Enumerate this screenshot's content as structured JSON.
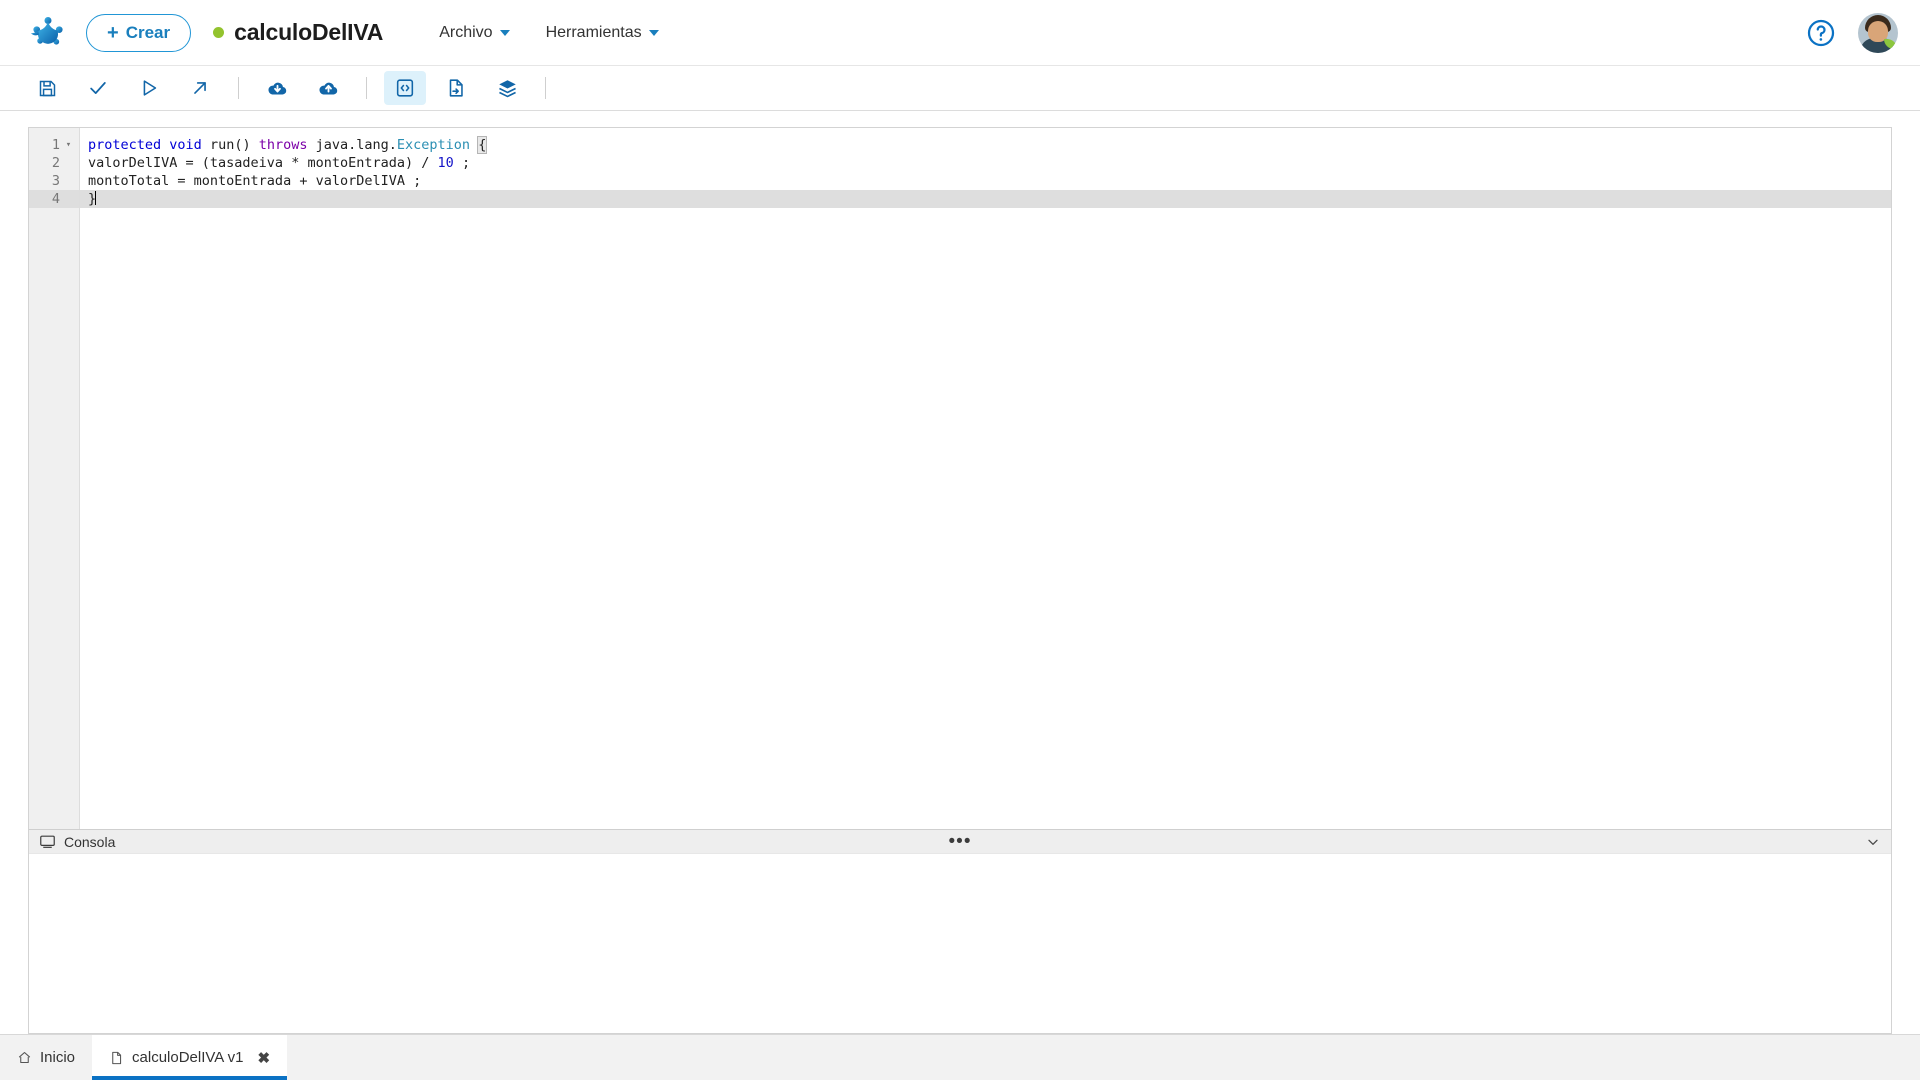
{
  "header": {
    "logo_icon": "mendix-frog-logo",
    "create_button": {
      "label": "Crear",
      "plus": "+"
    },
    "document": {
      "title": "calculoDelIVA",
      "status_dot_color": "#93c32e"
    },
    "menus": [
      {
        "label": "Archivo",
        "name": "menu-archivo"
      },
      {
        "label": "Herramientas",
        "name": "menu-herramientas"
      }
    ],
    "help_icon": "help-circle-icon",
    "avatar": "user-avatar"
  },
  "toolbar": {
    "buttons": [
      {
        "name": "save-button",
        "icon": "save-floppy-icon",
        "title": "Guardar",
        "active": false
      },
      {
        "name": "validate-button",
        "icon": "check-icon",
        "title": "Validar",
        "active": false
      },
      {
        "name": "run-button",
        "icon": "play-icon",
        "title": "Ejecutar",
        "active": false
      },
      {
        "name": "open-external-button",
        "icon": "external-link-arrow-icon",
        "title": "Abrir",
        "active": false
      },
      {
        "name": "download-button",
        "icon": "cloud-download-icon",
        "title": "Descargar",
        "active": false
      },
      {
        "name": "upload-button",
        "icon": "cloud-upload-icon",
        "title": "Subir",
        "active": false
      },
      {
        "name": "code-view-button",
        "icon": "code-brackets-icon",
        "title": "Código",
        "active": true
      },
      {
        "name": "document-button",
        "icon": "document-arrow-icon",
        "title": "Documento",
        "active": false
      },
      {
        "name": "layers-button",
        "icon": "stack-layers-icon",
        "title": "Capas",
        "active": false
      }
    ]
  },
  "editor": {
    "language": "java",
    "lines": [
      {
        "number": "1",
        "foldable": true,
        "current": false
      },
      {
        "number": "2",
        "foldable": false,
        "current": false
      },
      {
        "number": "3",
        "foldable": false,
        "current": false
      },
      {
        "number": "4",
        "foldable": false,
        "current": true
      }
    ],
    "code": {
      "line1": {
        "kw_protected": "protected",
        "kw_void": "void",
        "method": " run() ",
        "kw_throws": "throws",
        "pkg": " java.lang.",
        "type": "Exception",
        "brace": "{"
      },
      "line2": {
        "pre": "valorDelIVA = (tasadeiva ",
        "star": "*",
        "mid": " montoEntrada) ",
        "slash": "/",
        "num": "10",
        "end": " ;"
      },
      "line3": "montoTotal = montoEntrada + valorDelIVA ;",
      "line4": "}"
    }
  },
  "console": {
    "label": "Consola",
    "icon": "console-terminal-icon",
    "menu_dots": "•••",
    "collapse_icon": "chevron-down-icon"
  },
  "bottom_tabs": [
    {
      "name": "tab-inicio",
      "label": "Inicio",
      "icon": "home-icon",
      "active": false,
      "closable": false
    },
    {
      "name": "tab-calculodeliva-v1",
      "label": "calculoDelIVA v1",
      "icon": "file-icon",
      "active": true,
      "closable": true,
      "close_glyph": "✖"
    }
  ],
  "colors": {
    "accent": "#0b72c4",
    "brand_blue": "#1a7fbd",
    "status_green": "#93c32e",
    "toolbar_active_bg": "#ddf1fb"
  }
}
